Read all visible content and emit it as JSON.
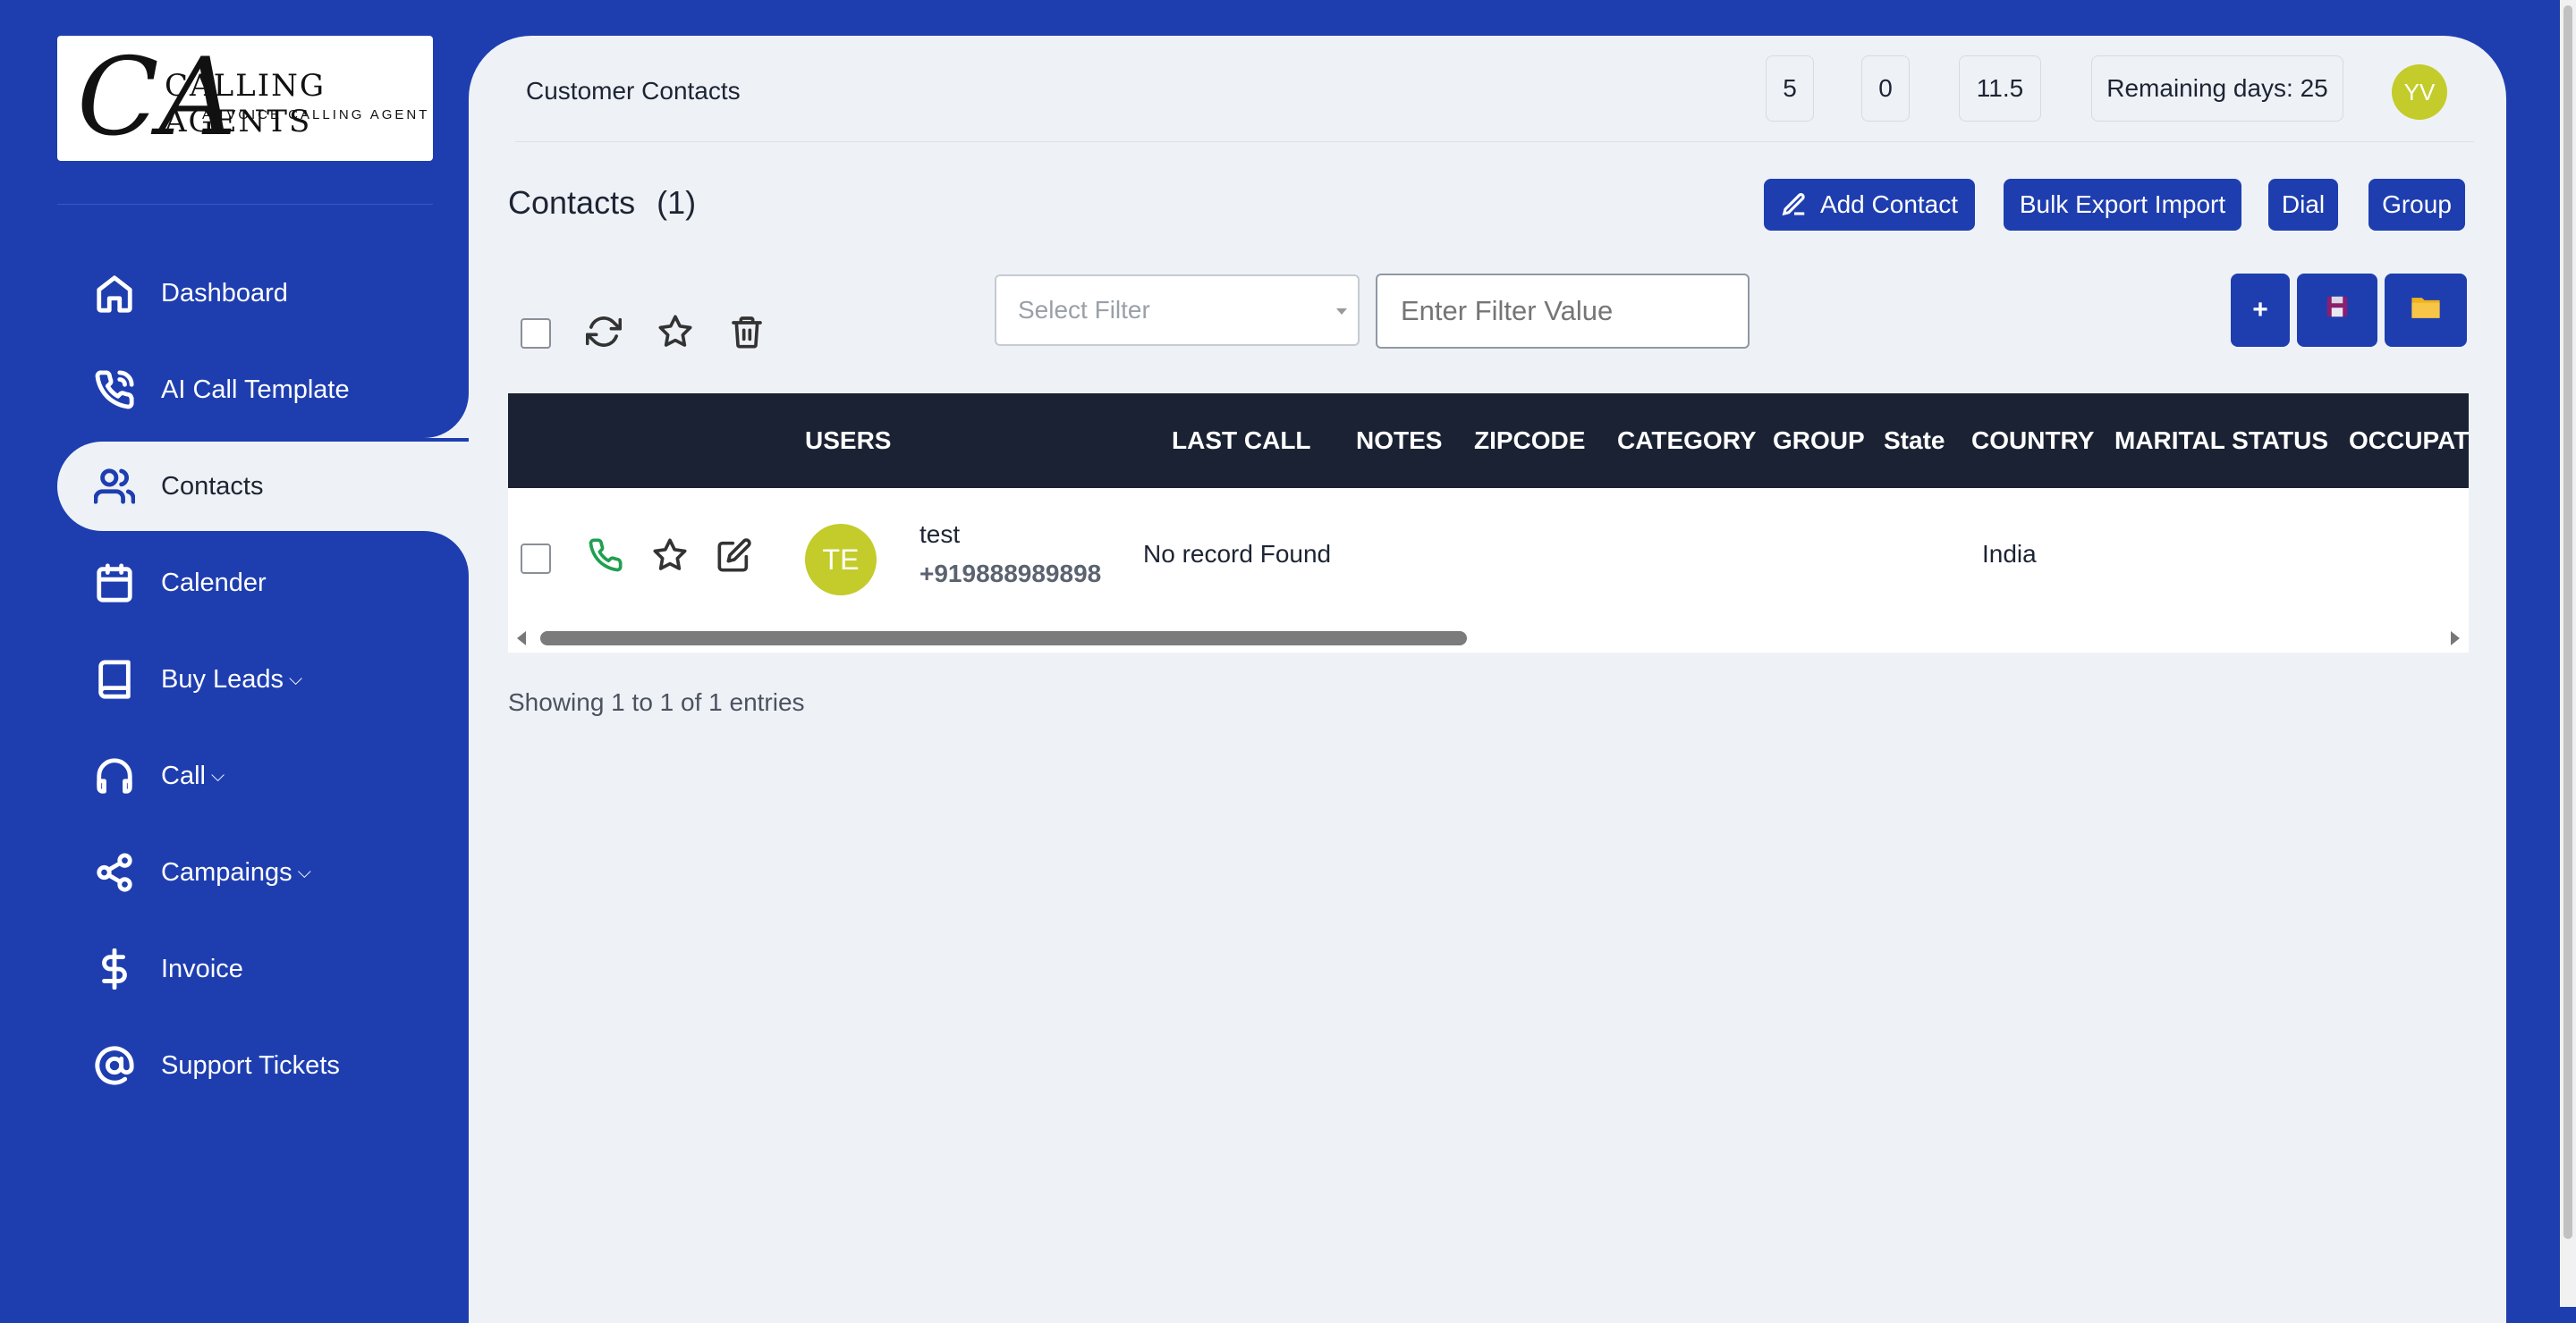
{
  "brand": {
    "name": "CALLING AGENTS",
    "tagline": "AI VOICE CALLING AGENT",
    "mark": "CA"
  },
  "sidebar": {
    "items": [
      {
        "label": "Dashboard",
        "icon": "home-icon"
      },
      {
        "label": "AI Call Template",
        "icon": "phone-icon"
      },
      {
        "label": "Contacts",
        "icon": "users-icon",
        "active": true
      },
      {
        "label": "Calender",
        "icon": "calendar-icon"
      },
      {
        "label": "Buy Leads",
        "icon": "book-icon",
        "dropdown": true
      },
      {
        "label": "Call",
        "icon": "headphones-icon",
        "dropdown": true
      },
      {
        "label": "Campaings",
        "icon": "share-icon",
        "dropdown": true
      },
      {
        "label": "Invoice",
        "icon": "dollar-icon"
      },
      {
        "label": "Support Tickets",
        "icon": "at-sign-icon"
      }
    ],
    "chevron": "⌵"
  },
  "header": {
    "title": "Customer Contacts",
    "stats": [
      "5",
      "0",
      "11.5"
    ],
    "remaining": "Remaining days: 25",
    "avatar_initials": "YV"
  },
  "contacts": {
    "title": "Contacts",
    "count": "(1)",
    "buttons": {
      "add": "Add Contact",
      "bulk": "Bulk Export Import",
      "dial": "Dial",
      "group": "Group"
    }
  },
  "filter": {
    "select_placeholder": "Select Filter",
    "value_placeholder": "Enter Filter Value",
    "add_label": "+"
  },
  "table": {
    "columns": [
      "USERS",
      "LAST CALL",
      "NOTES",
      "ZIPCODE",
      "CATEGORY",
      "GROUP",
      "State",
      "COUNTRY",
      "MARITAL STATUS",
      "OCCUPATION"
    ],
    "rows": [
      {
        "initials": "TE",
        "name": "test",
        "phone": "+919888989898",
        "last_call": "No record Found",
        "country": "India"
      }
    ]
  },
  "footer": {
    "showing": "Showing 1 to 1 of 1 entries"
  },
  "colors": {
    "primary": "#1e3eb0",
    "avatar": "#c3cc2a",
    "header_dark": "#1a2233",
    "panel": "#eef2f6",
    "phone_green": "#1fa050"
  }
}
